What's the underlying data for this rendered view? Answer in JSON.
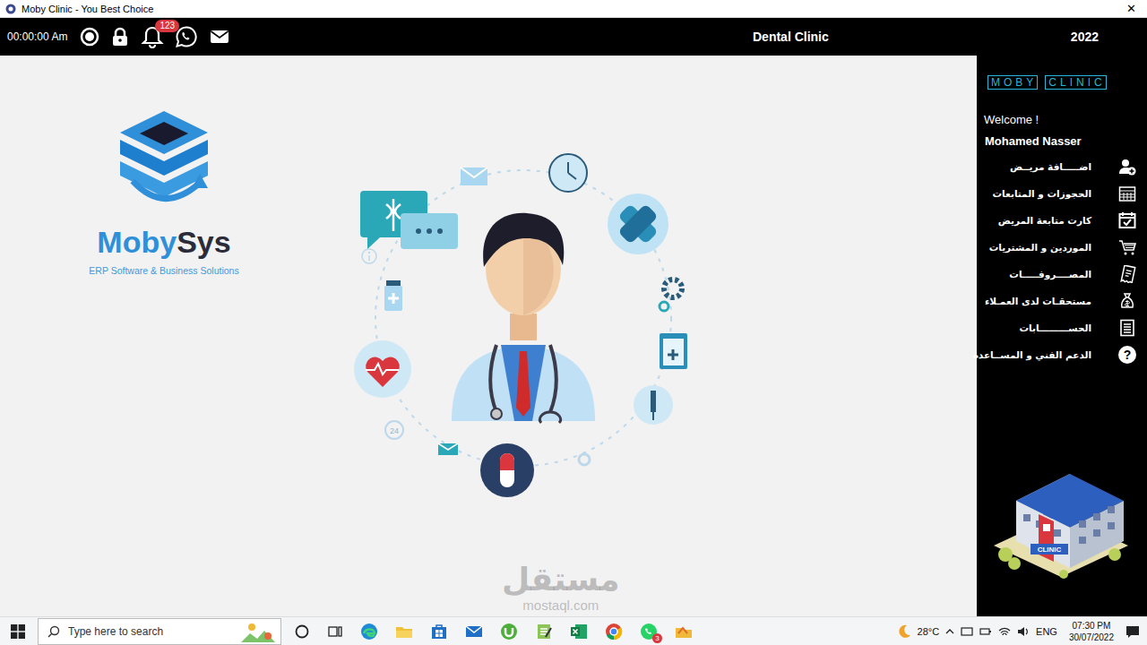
{
  "window": {
    "title": "Moby Clinic - You Best Choice",
    "close": "✕"
  },
  "topbar": {
    "time": "00:00:00 Am",
    "notifications": "123",
    "clinic": "Dental Clinic",
    "year": "2022"
  },
  "logo": {
    "name_first": "Moby",
    "name_second": "Sys",
    "tagline": "ERP Software & Business Solutions"
  },
  "illustration": {
    "clock_badge": "24"
  },
  "sidebar": {
    "brand": [
      "MOBY",
      "CLINIC"
    ],
    "welcome": "Welcome !",
    "user": "Mohamed Nasser",
    "help_glyph": "?",
    "items": [
      {
        "label": "اضـــــافة مريــض",
        "kind": "add-user"
      },
      {
        "label": "الحجوزات و المتابعات",
        "kind": "calendar"
      },
      {
        "label": "كارت متابعة المريض",
        "kind": "calendar-check"
      },
      {
        "label": "الموردين و المشتريات",
        "kind": "cart"
      },
      {
        "label": "المصــــروفـــــات",
        "kind": "receipt"
      },
      {
        "label": "مستحقـات لدى العمـلاء",
        "kind": "money"
      },
      {
        "label": "الحســـــــــابات",
        "kind": "list"
      },
      {
        "label": "الدعم الفني و المســاعدة",
        "kind": "help"
      }
    ],
    "building_sign": "CLINIC"
  },
  "taskbar": {
    "search_placeholder": "Type here to search",
    "app_badge": "3",
    "weather": "28°C",
    "language": "ENG",
    "time": "07:30 PM",
    "date": "30/07/2022"
  },
  "watermark": {
    "arabic": "مستقل",
    "latin": "mostaql.com"
  }
}
